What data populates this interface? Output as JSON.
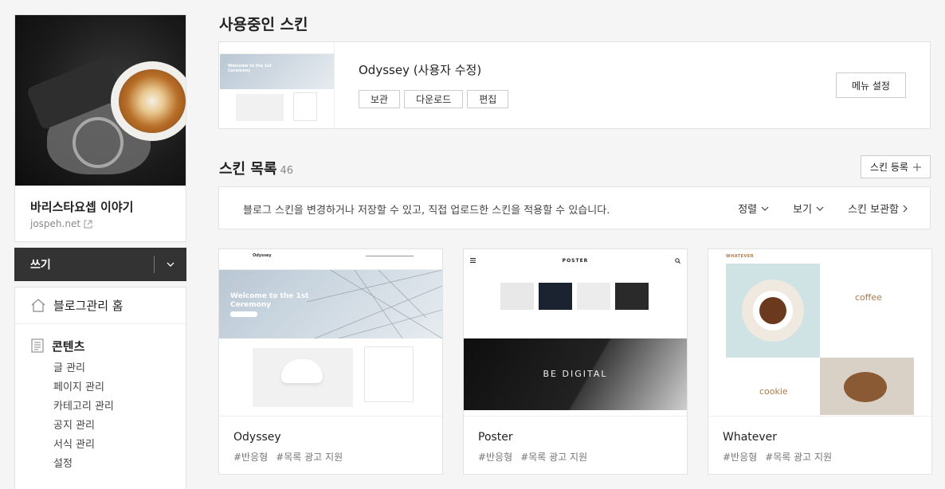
{
  "sidebar": {
    "profile": {
      "name": "바리스타요셉 이야기",
      "url": "jospeh.net"
    },
    "write": {
      "label": "쓰기"
    },
    "home": {
      "label": "블로그관리 홈"
    },
    "contents": {
      "label": "콘텐츠",
      "items": [
        "글 관리",
        "페이지 관리",
        "카테고리 관리",
        "공지 관리",
        "서식 관리",
        "설정"
      ]
    }
  },
  "current": {
    "heading": "사용중인 스킨",
    "name": "Odyssey (사용자 수정)",
    "buttons": [
      "보관",
      "다운로드",
      "편집"
    ],
    "menu_setting": "메뉴 설정",
    "thumb": {
      "title": "Welcome to the 1st Ceremony"
    }
  },
  "list": {
    "heading": "스킨 목록",
    "count": "46",
    "register": "스킨 등록",
    "info": "블로그 스킨을 변경하거나 저장할 수 있고, 직접 업로드한 스킨을 적용할 수 있습니다.",
    "actions": {
      "sort": "정렬",
      "view": "보기",
      "storage": "스킨 보관함"
    },
    "skins": [
      {
        "name": "Odyssey",
        "tags": [
          "#반응형",
          "#목록 광고 지원"
        ],
        "preview": {
          "logo": "Odyssey",
          "hero": "Welcome to the 1st Ceremony"
        }
      },
      {
        "name": "Poster",
        "tags": [
          "#반응형",
          "#목록 광고 지원"
        ],
        "preview": {
          "logo": "POSTER",
          "banner": "BE DIGITAL"
        }
      },
      {
        "name": "Whatever",
        "tags": [
          "#반응형",
          "#목록 광고 지원"
        ],
        "preview": {
          "logo": "WHATEVER",
          "label1": "coffee",
          "label2": "cookie"
        }
      }
    ]
  },
  "colors": {
    "write_bg": "#333333",
    "page_bg": "#f5f5f5",
    "card_border": "#e2e2e2"
  }
}
